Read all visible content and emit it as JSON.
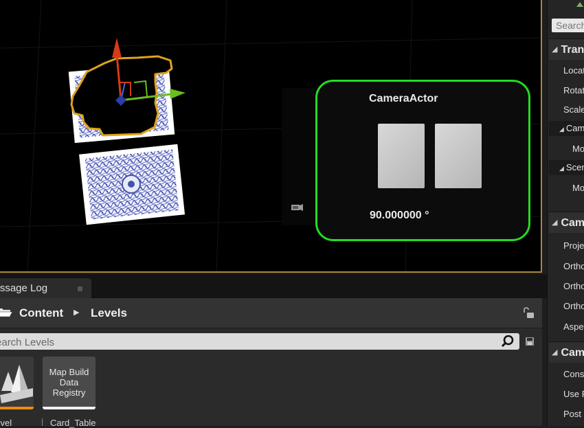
{
  "viewport": {
    "preview": {
      "title": "CameraActor",
      "fov_text": "90.000000 °"
    }
  },
  "details": {
    "search_placeholder": "Search",
    "headers": [
      "Transform",
      "Camera",
      "Camera"
    ],
    "props": [
      "Location",
      "Rotation",
      "Scale",
      "Mobility",
      "Mobility",
      "Projection Mode",
      "Ortho Width",
      "Ortho Near Clip",
      "Ortho Far Clip",
      "Aspect Ratio",
      "Constrain Aspect Ratio",
      "Use Field Of View",
      "Post Process"
    ],
    "subheaders": [
      "CameraComponent",
      "SceneComponent"
    ]
  },
  "tabbar": {
    "message_log_label": "Message Log"
  },
  "content_browser": {
    "path": [
      "Content",
      "Levels"
    ],
    "search_placeholder": "Search Levels",
    "assets": [
      {
        "name": "Level"
      },
      {
        "name": "Map Build Data Registry",
        "label": "Card_Table"
      }
    ],
    "accent_color": "#f08c00"
  },
  "colors": {
    "selection_outline": "#e0a21c",
    "preview_border": "#22dd22",
    "viewport_border": "#a9873d"
  }
}
